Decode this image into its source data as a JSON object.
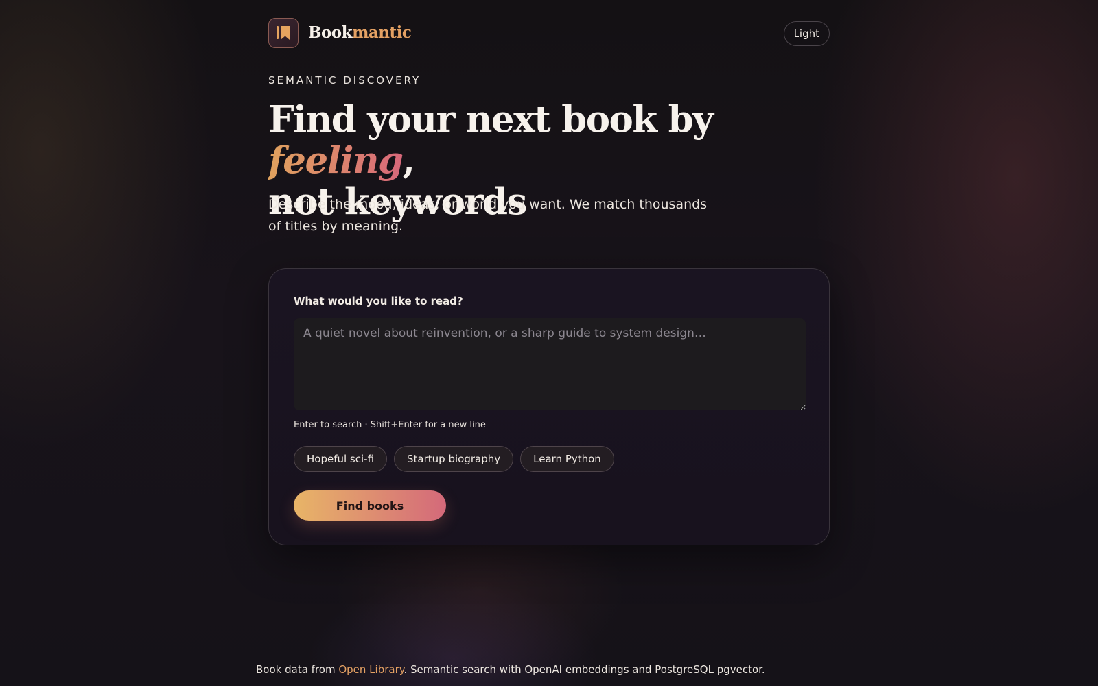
{
  "brand": {
    "part1": "Book",
    "part2": "mantic",
    "accent": "#e4a163"
  },
  "theme_toggle": {
    "label": "Light"
  },
  "hero": {
    "eyebrow": "SEMANTIC DISCOVERY",
    "headline_part1": "Find your next book by ",
    "headline_emphasis": "feeling",
    "headline_part2": ",",
    "headline_line2": "not keywords",
    "subtitle": "Describe the mood, ideas, or world you want. We match thousands of titles by meaning."
  },
  "search": {
    "label": "What would you like to read?",
    "placeholder": "A quiet novel about reinvention, or a sharp guide to system design…",
    "value": "",
    "hint": "Enter to search · Shift+Enter for a new line",
    "suggestions": [
      "Hopeful sci-fi",
      "Startup biography",
      "Learn Python"
    ],
    "submit_label": "Find books"
  },
  "footer": {
    "prefix": "Book data from ",
    "link_text": "Open Library",
    "suffix": ". Semantic search with OpenAI embeddings and PostgreSQL pgvector."
  },
  "colors": {
    "background": "#151218",
    "button_gradient_start": "#e8b567",
    "button_gradient_end": "#d4697a"
  },
  "icons": {
    "logo": "book-bookmark-icon"
  }
}
